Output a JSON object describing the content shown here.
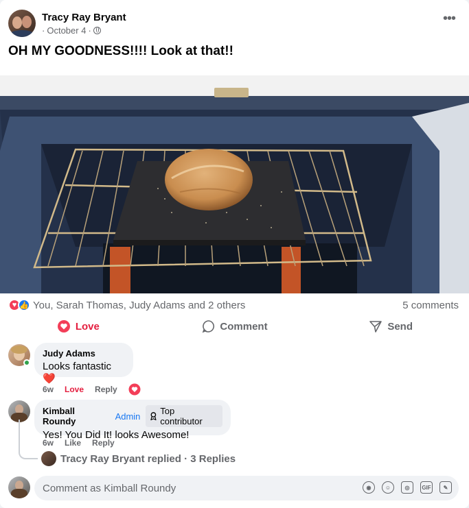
{
  "post": {
    "author": "Tracy Ray Bryant",
    "date": "October 4",
    "sep": "·",
    "text": "OH MY GOODNESS!!!! Look at that!!",
    "more_icon": "•••"
  },
  "reactions": {
    "summary": "You, Sarah Thomas, Judy Adams and 2 others",
    "comments_count": "5 comments"
  },
  "actions": {
    "love": "Love",
    "comment": "Comment",
    "send": "Send"
  },
  "comments": [
    {
      "name": "Judy Adams",
      "text": "Looks fantastic ❤️",
      "age": "6w",
      "reacted": "Love",
      "reply": "Reply"
    },
    {
      "name": "Kimball Roundy",
      "role": "Admin",
      "badge": "Top contributor",
      "text": "Yes! You Did It! looks Awesome!",
      "age": "6w",
      "like": "Like",
      "reply": "Reply"
    }
  ],
  "thread": {
    "replied": "Tracy Ray Bryant replied · 3 Replies"
  },
  "composer": {
    "placeholder": "Comment as Kimball Roundy",
    "gif": "GIF"
  },
  "colors": {
    "love": "#e41e3f",
    "like": "#1877f2",
    "muted": "#65676b",
    "bubble": "#f0f2f5"
  }
}
